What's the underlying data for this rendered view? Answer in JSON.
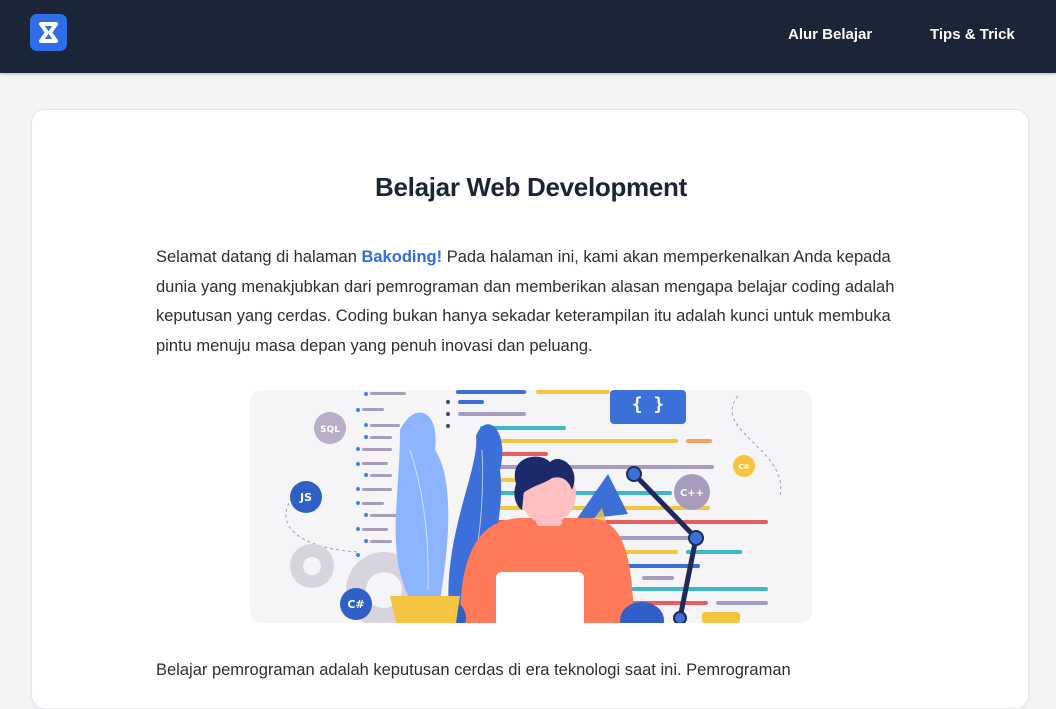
{
  "nav": {
    "links": [
      {
        "label": "Alur Belajar"
      },
      {
        "label": "Tips & Trick"
      }
    ]
  },
  "main": {
    "title": "Belajar Web Development",
    "intro_prefix": "Selamat datang di halaman ",
    "brand": "Bakoding!",
    "intro_suffix": " Pada halaman ini, kami akan memperkenalkan Anda kepada dunia yang menakjubkan dari pemrograman dan memberikan alasan mengapa belajar coding adalah keputusan yang cerdas. Coding bukan hanya sekadar keterampilan itu adalah kunci untuk membuka pintu menuju masa depan yang penuh inovasi dan peluang.",
    "next_paragraph": "Belajar pemrograman adalah keputusan cerdas di era teknologi saat ini. Pemrograman"
  },
  "illustration": {
    "badges": [
      "SQL",
      "JS",
      "C#",
      "C++",
      "C#"
    ],
    "braces": "{ }"
  },
  "colors": {
    "navbar": "#1c2438",
    "accent": "#2f6ee6",
    "person_shirt": "#ff7a59"
  }
}
